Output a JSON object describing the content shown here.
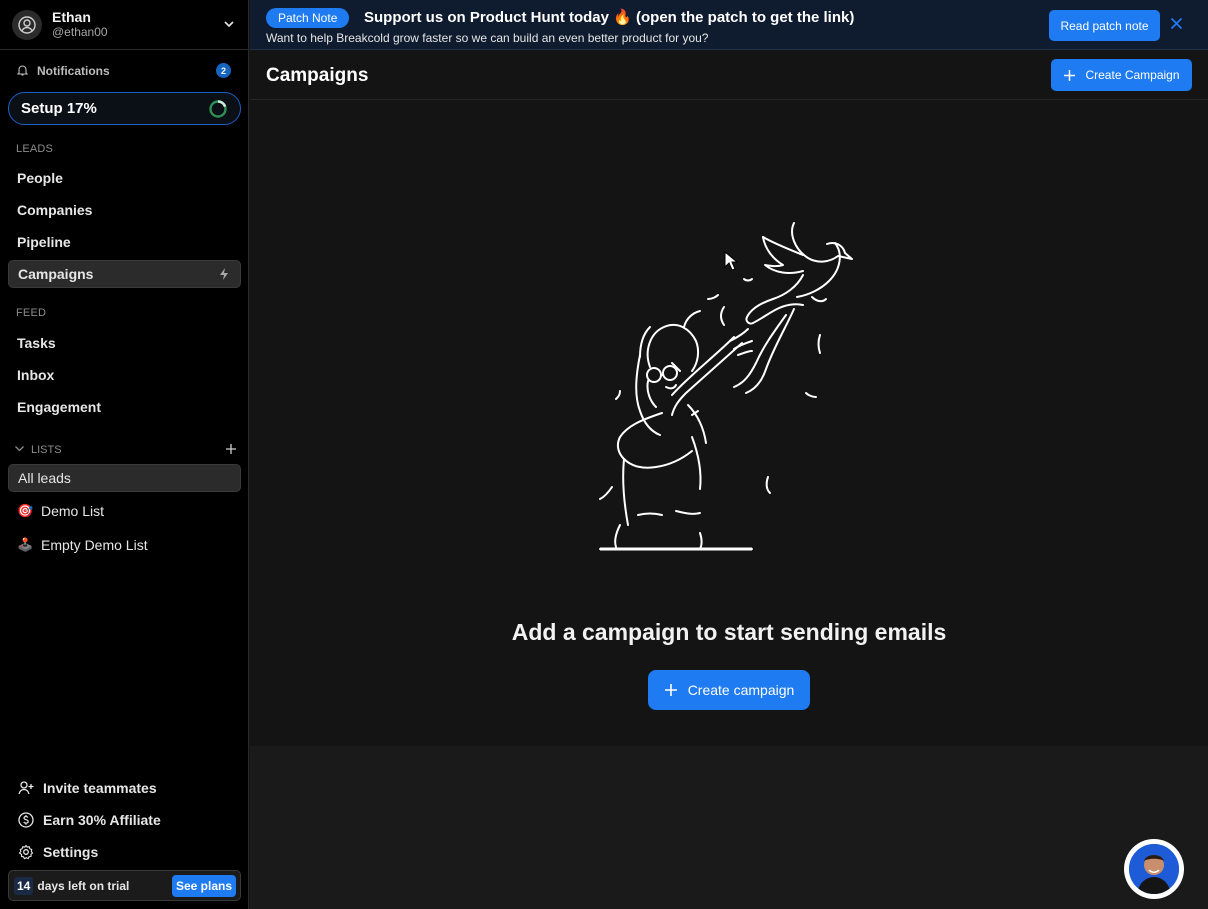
{
  "user": {
    "name": "Ethan",
    "handle": "@ethan00"
  },
  "notifications": {
    "label": "Notifications",
    "count": "2"
  },
  "setup": {
    "label": "Setup 17%",
    "progress": 0.17
  },
  "sidebar": {
    "leads_section": "LEADS",
    "leads": [
      "People",
      "Companies",
      "Pipeline",
      "Campaigns"
    ],
    "feed_section": "FEED",
    "feed": [
      "Tasks",
      "Inbox",
      "Engagement"
    ],
    "lists_section": "LISTS",
    "lists": [
      {
        "label": "All leads",
        "icon": ""
      },
      {
        "label": "Demo List",
        "icon": "🎯"
      },
      {
        "label": "Empty Demo List",
        "icon": "🕹️"
      }
    ],
    "bottom": [
      "Invite teammates",
      "Earn 30% Affiliate",
      "Settings"
    ]
  },
  "trial": {
    "days": "14",
    "text": "days left on trial",
    "button": "See plans"
  },
  "banner": {
    "pill": "Patch Note",
    "title": "Support us on Product Hunt today 🔥 (open the patch to get the link)",
    "subtitle": "Want to help Breakcold grow faster so we can build an even better product for you?",
    "button": "Read patch note"
  },
  "header": {
    "title": "Campaigns",
    "button": "Create Campaign"
  },
  "empty_state": {
    "title": "Add a campaign to start sending emails",
    "button": "Create campaign"
  },
  "colors": {
    "accent": "#1e7bf2",
    "sidebar_bg": "#000000",
    "main_bg": "#141414",
    "banner_bg": "#0f1b2e"
  }
}
